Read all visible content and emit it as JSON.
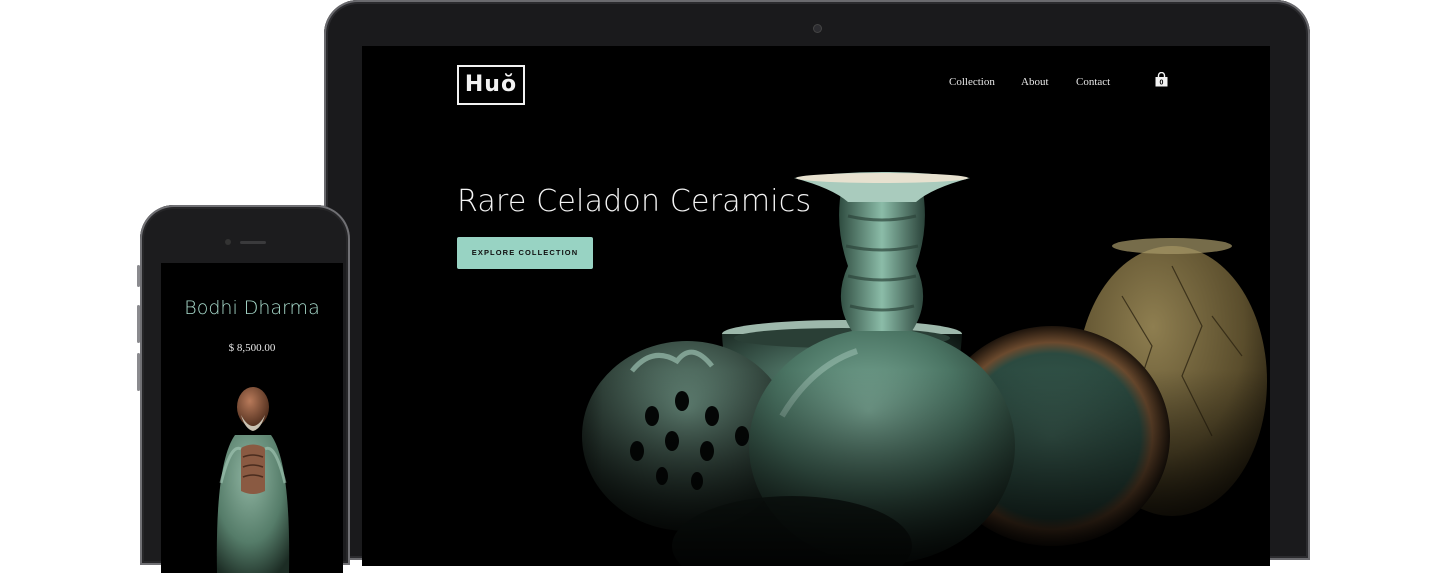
{
  "desktop": {
    "brand": {
      "logo_text": "Huŏ"
    },
    "nav": {
      "items": [
        "Collection",
        "About",
        "Contact"
      ],
      "cart_icon": "shopping-bag-icon",
      "cart_count": "0"
    },
    "hero": {
      "title": "Rare Celadon Ceramics",
      "cta_label": "EXPLORE COLLECTION"
    }
  },
  "mobile": {
    "product": {
      "name": "Bodhi Dharma",
      "price": "$ 8,500.00"
    }
  },
  "colors": {
    "background": "#000000",
    "accent": "#98d3c3",
    "mobile_title": "#a9dccd",
    "text": "#f4f4f4",
    "celadon": "#4f7a68"
  }
}
